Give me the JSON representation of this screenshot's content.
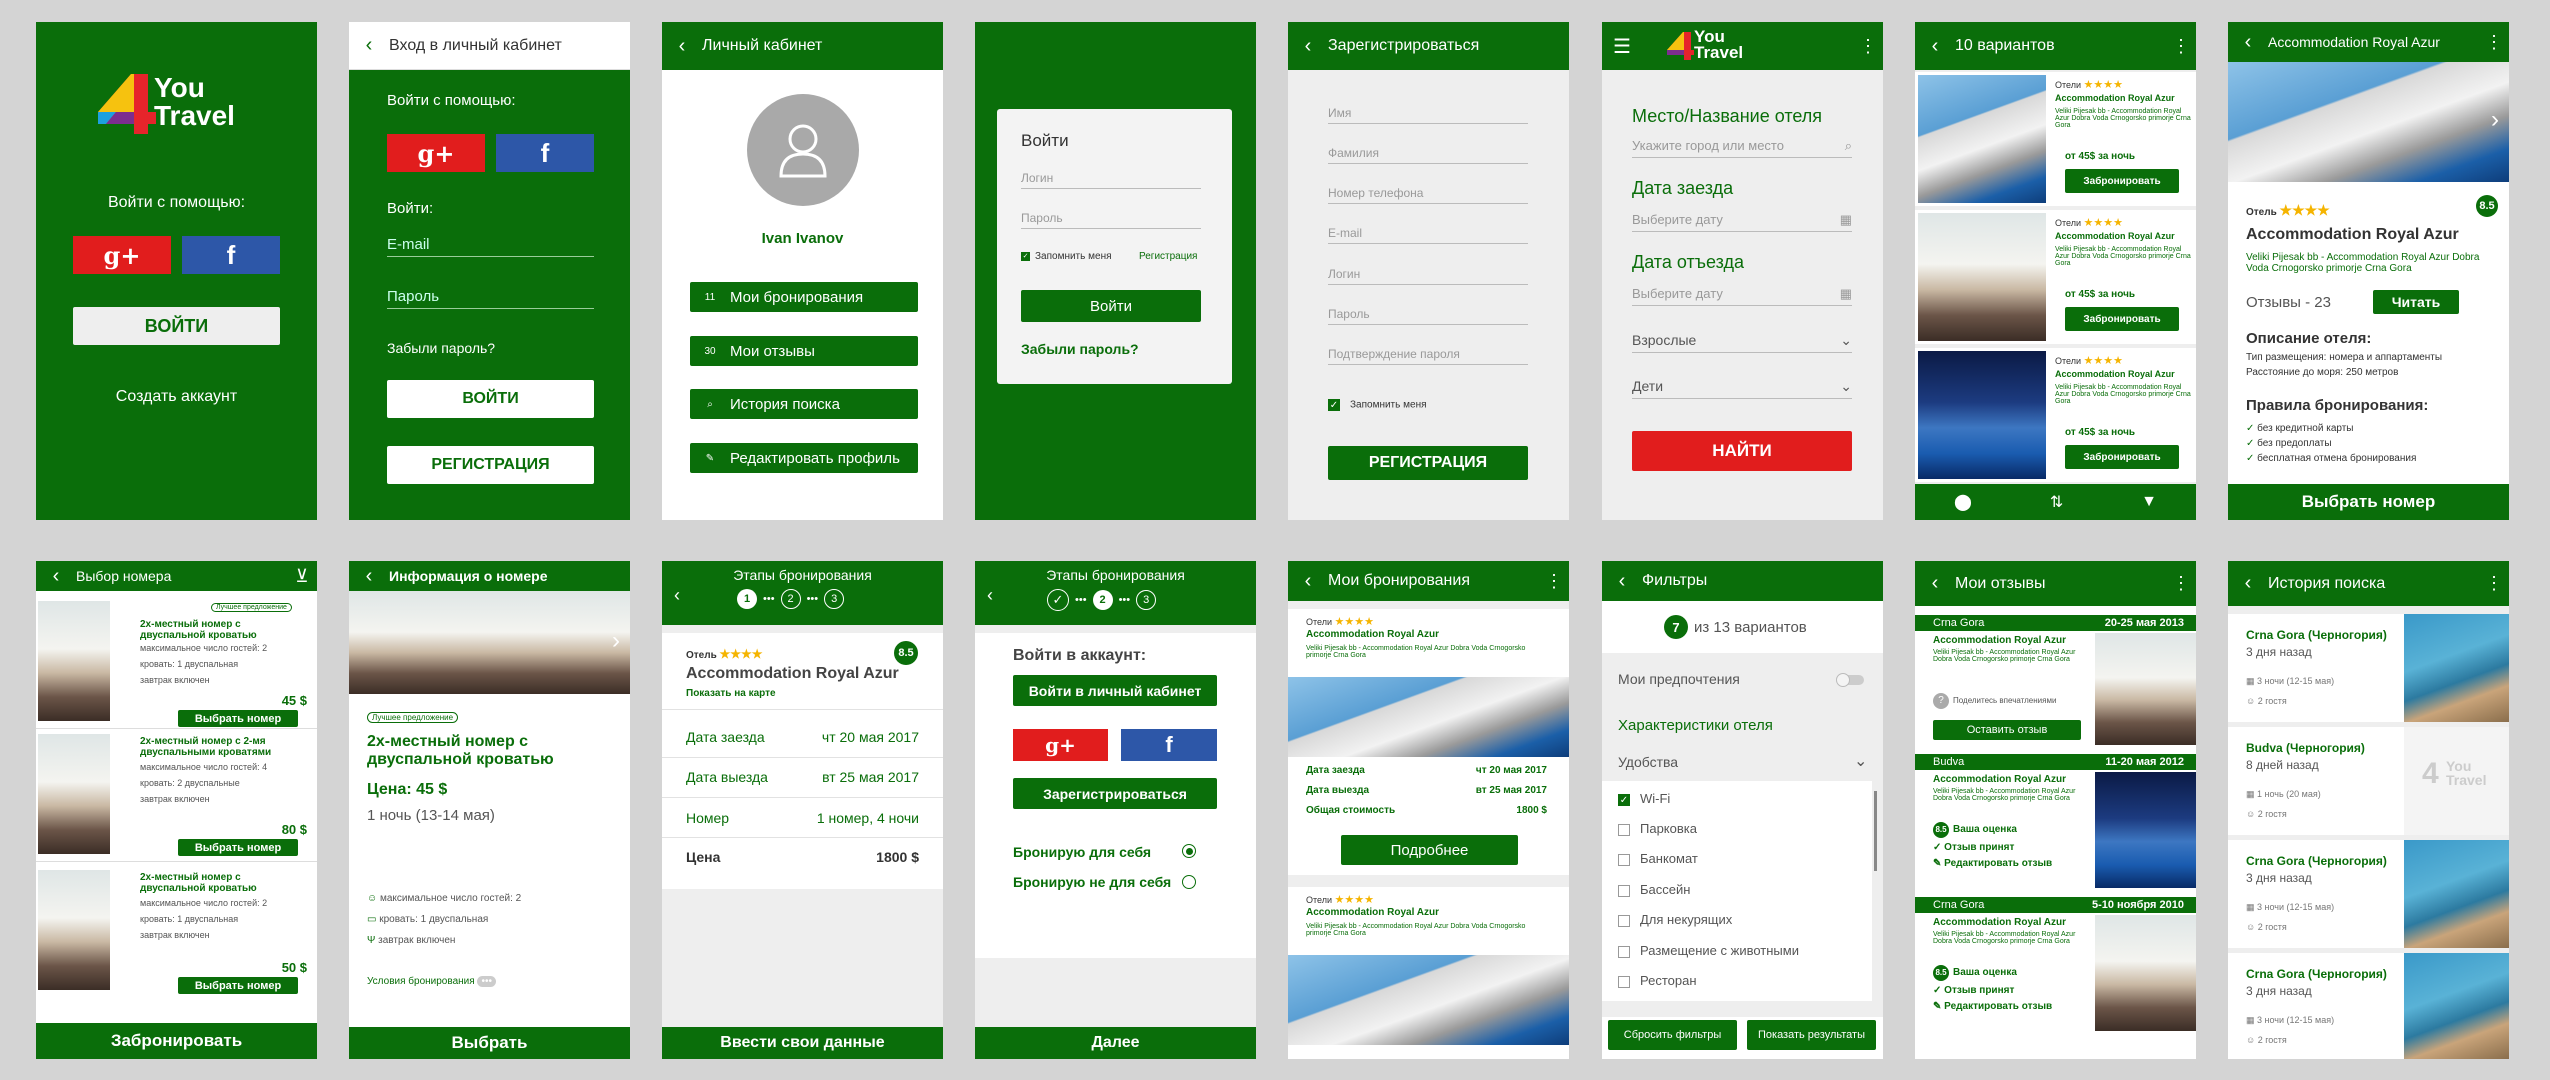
{
  "logo": {
    "you": "You",
    "travel": "Travel"
  },
  "s1": {
    "login_with": "Войти с помощью:",
    "login_btn": "ВОЙТИ",
    "create": "Создать аккаунт"
  },
  "s2": {
    "title": "Вход в личный кабинет",
    "login_with": "Войти с помощью:",
    "login": "Войти:",
    "email": "E-mail",
    "password": "Пароль",
    "forgot": "Забыли пароль?",
    "login_btn": "ВОЙТИ",
    "register_btn": "РЕГИСТРАЦИЯ"
  },
  "s3": {
    "title": "Личный кабинет",
    "name": "Ivan Ivanov",
    "items": [
      {
        "count": "11",
        "label": "Мои бронирования"
      },
      {
        "count": "30",
        "label": "Мои отзывы"
      },
      {
        "count": "",
        "label": "История поиска"
      },
      {
        "count": "",
        "label": "Редактировать профиль"
      }
    ]
  },
  "s4": {
    "title": "Войти",
    "login": "Логин",
    "password": "Пароль",
    "remember": "Запомнить меня",
    "register": "Регистрация",
    "login_btn": "Войти",
    "forgot": "Забыли пароль?"
  },
  "s5": {
    "title": "Зарегистрироваться",
    "fields": [
      "Имя",
      "Фамилия",
      "Номер телефона",
      "E-mail",
      "Логин",
      "Пароль",
      "Подтверждение пароля"
    ],
    "remember": "Запомнить меня",
    "btn": "РЕГИСТРАЦИЯ"
  },
  "s6": {
    "place_label": "Место/Название отеля",
    "place_ph": "Укажите город или место",
    "in_label": "Дата заезда",
    "in_ph": "Выберите дату",
    "out_label": "Дата отъезда",
    "out_ph": "Выберите дату",
    "adults": "Взрослые",
    "children": "Дети",
    "find": "НАЙТИ"
  },
  "s7": {
    "title": "10 вариантов",
    "hotel_label": "Отели",
    "name": "Accommodation Royal Azur",
    "addr": "Veliki Pijesak bb - Accommodation Royal Azur Dobra Voda Crnogorsko primorje Crna Gora",
    "price": "от 45$ за ночь",
    "book": "Забронировать"
  },
  "s8": {
    "title": "Accommodation Royal Azur",
    "hotel_label": "Отель",
    "score": "8.5",
    "name": "Accommodation Royal Azur",
    "addr": "Veliki Pijesak bb - Accommodation Royal Azur Dobra Voda Crnogorsko primorje Crna Gora",
    "reviews": "Отзывы - 23",
    "read": "Читать",
    "desc_title": "Описание отеля:",
    "desc1": "Тип размещения: номера и аппартаменты",
    "desc2": "Расстояние до моря: 250 метров",
    "rules_title": "Правила бронирования:",
    "rules": [
      "без кредитной карты",
      "без предоплаты",
      "бесплатная отмена бронирования"
    ],
    "choose": "Выбрать номер"
  },
  "s9": {
    "title": "Выбор номера",
    "badge": "Лучшее предложение",
    "rooms": [
      {
        "name": "2х-местный номер с двуспальной кроватью",
        "guests": "максимальное число гостей: 2",
        "bed": "кровать: 1 двуспальная",
        "food": "завтрак включен",
        "price": "45 $",
        "btn": "Выбрать номер"
      },
      {
        "name": "2х-местный номер с 2-мя двуспальными кроватями",
        "guests": "максимальное число гостей: 4",
        "bed": "кровать: 2 двуспальные",
        "food": "завтрак включен",
        "price": "80 $",
        "btn": "Выбрать номер"
      },
      {
        "name": "2х-местный номер с двуспальной кроватью",
        "guests": "максимальное число гостей: 2",
        "bed": "кровать: 1 двуспальная",
        "food": "завтрак включен",
        "price": "50 $",
        "btn": "Выбрать номер"
      }
    ],
    "bottom": "Забронировать"
  },
  "s10": {
    "title": "Информация о номере",
    "badge": "Лучшее предложение",
    "name": "2х-местный номер с двуспальной кроватью",
    "price": "Цена: 45 $",
    "nights": "1 ночь (13-14 мая)",
    "guests": "максимальное число гостей: 2",
    "bed": "кровать: 1 двуспальная",
    "food": "завтрак включен",
    "conditions": "Условия бронирования",
    "bottom": "Выбрать"
  },
  "s11": {
    "title": "Этапы бронирования",
    "steps": [
      "1",
      "2",
      "3"
    ],
    "hotel_label": "Отель",
    "score": "8.5",
    "name": "Accommodation Royal Azur",
    "map": "Показать на карте",
    "rows": [
      {
        "k": "Дата заезда",
        "v": "чт 20 мая 2017"
      },
      {
        "k": "Дата выезда",
        "v": "вт 25 мая 2017"
      },
      {
        "k": "Номер",
        "v": "1 номер, 4 ночи"
      },
      {
        "k": "Цена",
        "v": "1800 $"
      }
    ],
    "bottom": "Ввести свои данные"
  },
  "s12": {
    "title": "Этапы бронирования",
    "steps": [
      "2",
      "3"
    ],
    "login_title": "Войти в аккаунт:",
    "cabinet": "Войти в личный кабинет",
    "register": "Зарегистрироваться",
    "self": "Бронирую для себя",
    "other": "Бронирую не для себя",
    "bottom": "Далее"
  },
  "s13": {
    "title": "Мои бронирования",
    "hotel_label": "Отели",
    "name": "Accommodation Royal Azur",
    "addr": "Veliki Pijesak bb - Accommodation Royal Azur Dobra Voda Crnogorsko primorje Crna Gora",
    "rows": [
      {
        "k": "Дата заезда",
        "v": "чт 20 мая 2017"
      },
      {
        "k": "Дата выезда",
        "v": "вт 25 мая 2017"
      },
      {
        "k": "Общая стоимость",
        "v": "1800 $"
      }
    ],
    "more": "Подробнее"
  },
  "s14": {
    "title": "Фильтры",
    "count": "7",
    "of": "из 13 вариантов",
    "prefs": "Мои предпочтения",
    "chars": "Характеристики отеля",
    "amen": "Удобства",
    "items": [
      "Wi-Fi",
      "Парковка",
      "Банкомат",
      "Бассейн",
      "Для некурящих",
      "Размещение с животными",
      "Ресторан"
    ],
    "reset": "Сбросить фильтры",
    "show": "Показать результаты"
  },
  "s15": {
    "title": "Мои отзывы",
    "reviews": [
      {
        "place": "Crna Gora",
        "date": "20-25 мая 2013",
        "share": "Поделитесь впечатлениями",
        "btn": "Оставить отзыв"
      },
      {
        "place": "Budva",
        "date": "11-20 мая 2012",
        "score": "8.5",
        "your": "Ваша оценка",
        "accepted": "Отзыв принят",
        "edit": "Редактировать отзыв"
      },
      {
        "place": "Crna Gora",
        "date": "5-10 ноября 2010",
        "score": "8.5",
        "your": "Ваша оценка",
        "accepted": "Отзыв принят",
        "edit": "Редактировать отзыв"
      }
    ],
    "name": "Accommodation Royal Azur",
    "addr": "Veliki Pijesak bb - Accommodation Royal Azur Dobra Voda Crnogorsko primorje Crna Gora"
  },
  "s16": {
    "title": "История поиска",
    "items": [
      {
        "place": "Crna Gora (Черногория)",
        "ago": "3 дня назад",
        "nights": "3 ночи (12-15 мая)",
        "guests": "2 гостя"
      },
      {
        "place": "Budva (Черногория)",
        "ago": "8 дней назад",
        "nights": "1 ночь (20 мая)",
        "guests": "2 гостя"
      },
      {
        "place": "Crna Gora (Черногория)",
        "ago": "3 дня назад",
        "nights": "3 ночи (12-15 мая)",
        "guests": "2 гостя"
      },
      {
        "place": "Crna Gora (Черногория)",
        "ago": "3 дня назад",
        "nights": "3 ночи (12-15 мая)",
        "guests": "2 гостя"
      }
    ]
  }
}
